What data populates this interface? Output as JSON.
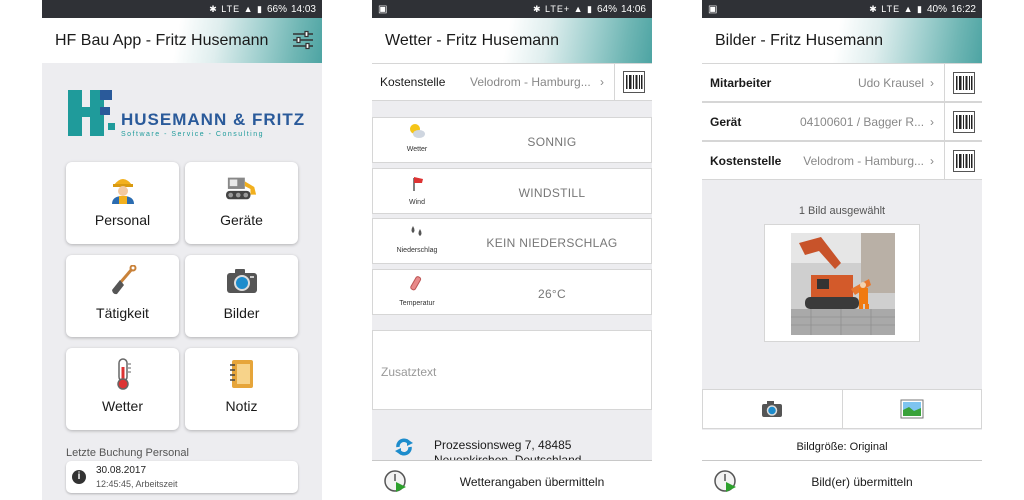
{
  "screen1": {
    "status": {
      "icons": "✱ LTE ▲ ▮",
      "battery": "66%",
      "time": "14:03"
    },
    "title": "HF Bau App - Fritz Husemann",
    "logo": {
      "letters": "HF",
      "company": "HUSEMANN & FRITZ",
      "tagline": "Software - Service - Consulting"
    },
    "tiles": [
      {
        "label": "Personal",
        "icon": "worker-icon"
      },
      {
        "label": "Geräte",
        "icon": "excavator-icon"
      },
      {
        "label": "Tätigkeit",
        "icon": "shovel-icon"
      },
      {
        "label": "Bilder",
        "icon": "camera-icon"
      },
      {
        "label": "Wetter",
        "icon": "thermometer-icon"
      },
      {
        "label": "Notiz",
        "icon": "notebook-icon"
      }
    ],
    "last_booking": {
      "label": "Letzte Buchung Personal",
      "date": "30.08.2017",
      "detail": "12:45:45, Arbeitszeit"
    },
    "colors": {
      "accent": "#1f9b9b",
      "logo_blue": "#2a5a9a"
    }
  },
  "screen2": {
    "status": {
      "icons": "✱ LTE+ ▲ ▮",
      "battery": "64%",
      "time": "14:06"
    },
    "title": "Wetter - Fritz Husemann",
    "kostenstelle": {
      "label": "Kostenstelle",
      "value": "Velodrom - Hamburg..."
    },
    "weather": [
      {
        "label": "Wetter",
        "value": "SONNIG"
      },
      {
        "label": "Wind",
        "value": "WINDSTILL"
      },
      {
        "label": "Niederschlag",
        "value": "KEIN NIEDERSCHLAG"
      },
      {
        "label": "Temperatur",
        "value": "26°C"
      }
    ],
    "zusatztext_placeholder": "Zusatztext",
    "address": {
      "line1": "Prozessionsweg 7, 48485",
      "line2": "Neuenkirchen, Deutschland"
    },
    "submit": "Wetterangaben übermitteln"
  },
  "screen3": {
    "status": {
      "icons": "✱ LTE ▲ ▮",
      "battery": "40%",
      "time": "16:22"
    },
    "title": "Bilder - Fritz Husemann",
    "rows": [
      {
        "label": "Mitarbeiter",
        "value": "Udo Krausel"
      },
      {
        "label": "Gerät",
        "value": "04100601 / Bagger R..."
      },
      {
        "label": "Kostenstelle",
        "value": "Velodrom - Hamburg..."
      }
    ],
    "selected_count": "1 Bild ausgewählt",
    "bildgroesse": "Bildgröße: Original",
    "submit": "Bild(er) übermitteln"
  }
}
